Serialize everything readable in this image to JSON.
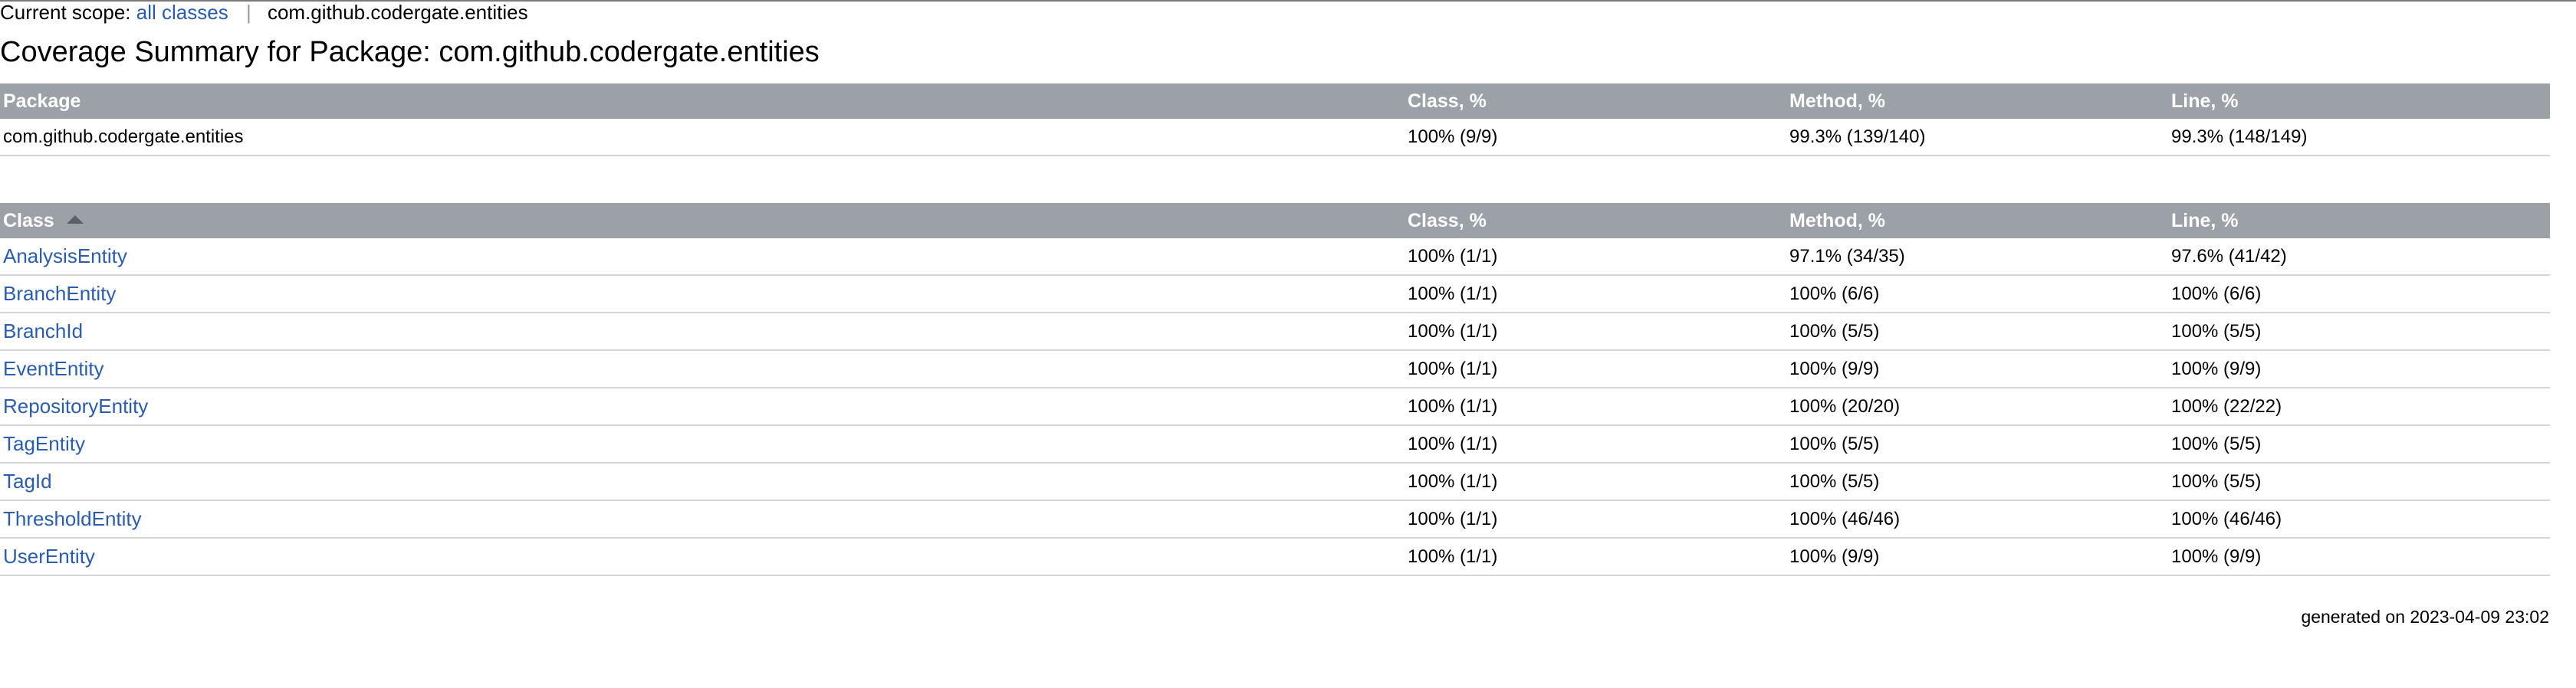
{
  "breadcrumb": {
    "label": "Current scope:",
    "all_classes_link": "all classes",
    "separator": "|",
    "current": "com.github.codergate.entities"
  },
  "title": "Coverage Summary for Package: com.github.codergate.entities",
  "package_table": {
    "headers": [
      "Package",
      "Class, %",
      "Method, %",
      "Line, %"
    ],
    "rows": [
      [
        "com.github.codergate.entities",
        "100% (9/9)",
        "99.3% (139/140)",
        "99.3% (148/149)"
      ]
    ]
  },
  "class_table": {
    "headers": [
      "Class",
      "Class, %",
      "Method, %",
      "Line, %"
    ],
    "sort_icon": "sort-ascending-icon",
    "rows": [
      [
        "AnalysisEntity",
        "100% (1/1)",
        "97.1% (34/35)",
        "97.6% (41/42)"
      ],
      [
        "BranchEntity",
        "100% (1/1)",
        "100% (6/6)",
        "100% (6/6)"
      ],
      [
        "BranchId",
        "100% (1/1)",
        "100% (5/5)",
        "100% (5/5)"
      ],
      [
        "EventEntity",
        "100% (1/1)",
        "100% (9/9)",
        "100% (9/9)"
      ],
      [
        "RepositoryEntity",
        "100% (1/1)",
        "100% (20/20)",
        "100% (22/22)"
      ],
      [
        "TagEntity",
        "100% (1/1)",
        "100% (5/5)",
        "100% (5/5)"
      ],
      [
        "TagId",
        "100% (1/1)",
        "100% (5/5)",
        "100% (5/5)"
      ],
      [
        "ThresholdEntity",
        "100% (1/1)",
        "100% (46/46)",
        "100% (46/46)"
      ],
      [
        "UserEntity",
        "100% (1/1)",
        "100% (9/9)",
        "100% (9/9)"
      ]
    ]
  },
  "footer": "generated on 2023-04-09 23:02",
  "colors": {
    "header_bg": "#9ca1a8",
    "link": "#2a5db0",
    "row_border": "#d5d5d5"
  }
}
